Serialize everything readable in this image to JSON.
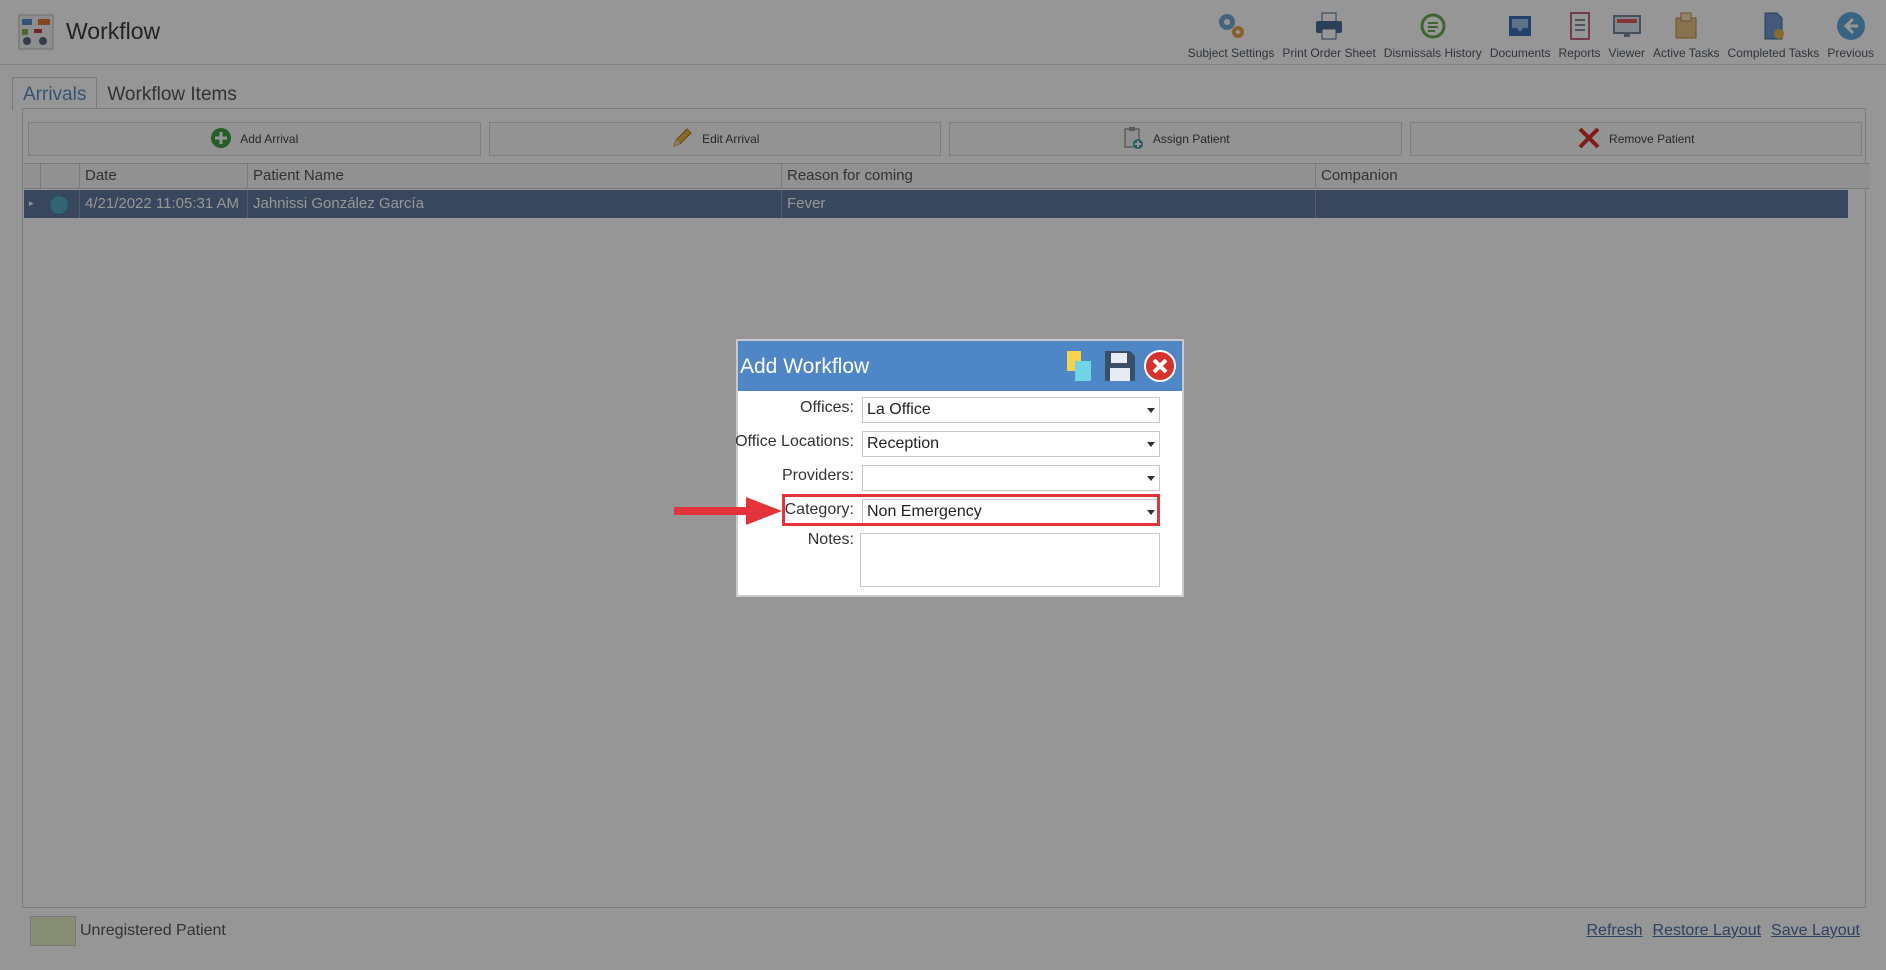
{
  "header": {
    "title": "Workflow",
    "toolbar": [
      {
        "label": "Subject Settings",
        "icon": "gears-icon"
      },
      {
        "label": "Print Order Sheet",
        "icon": "printer-icon"
      },
      {
        "label": "Dismissals History",
        "icon": "history-icon"
      },
      {
        "label": "Documents",
        "icon": "inbox-tray-icon"
      },
      {
        "label": "Reports",
        "icon": "report-icon"
      },
      {
        "label": "Viewer",
        "icon": "monitor-icon"
      },
      {
        "label": "Active Tasks",
        "icon": "task-box-icon"
      },
      {
        "label": "Completed Tasks",
        "icon": "completed-doc-icon"
      },
      {
        "label": "Previous",
        "icon": "back-arrow-icon"
      }
    ]
  },
  "tabs": [
    "Arrivals",
    "Workflow Items"
  ],
  "actions": {
    "add": "Add Arrival",
    "edit": "Edit Arrival",
    "assign": "Assign Patient",
    "remove": "Remove Patient"
  },
  "grid": {
    "columns": [
      "Date",
      "Patient Name",
      "Reason for coming",
      "Companion"
    ],
    "rows": [
      {
        "date": "4/21/2022 11:05:31 AM",
        "patient": "Jahnissi González García",
        "reason": "Fever",
        "companion": ""
      }
    ]
  },
  "footer": {
    "legend": "Unregistered Patient",
    "links": [
      "Refresh",
      "Restore Layout",
      "Save Layout"
    ]
  },
  "dialog": {
    "title": "Add Workflow",
    "fields": {
      "offices": {
        "label": "Offices:",
        "value": "La Office"
      },
      "locations": {
        "label": "Office Locations:",
        "value": "Reception"
      },
      "providers": {
        "label": "Providers:",
        "value": ""
      },
      "category": {
        "label": "Category:",
        "value": "Non Emergency"
      },
      "notes": {
        "label": "Notes:",
        "value": ""
      }
    }
  },
  "colors": {
    "accent": "#4f86c6",
    "selected_row": "#5f7a9f",
    "highlight": "#e5333b",
    "legend_swatch": "#e6f1c6"
  }
}
